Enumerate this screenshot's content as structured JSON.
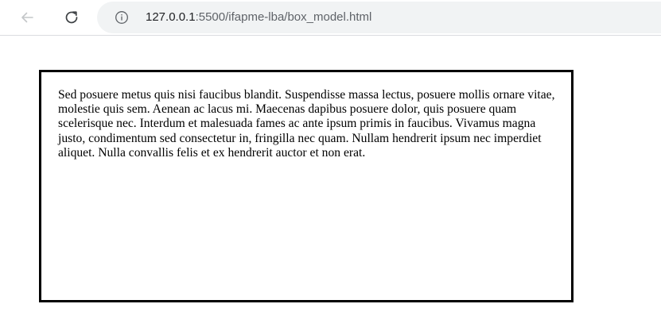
{
  "browser": {
    "url_host": "127.0.0.1",
    "url_path": ":5500/ifapme-lba/box_model.html",
    "icons": {
      "back": "arrow-left-icon",
      "reload": "reload-icon",
      "site_info": "info-icon"
    }
  },
  "page": {
    "paragraph": "Sed posuere metus quis nisi faucibus blandit. Suspendisse massa lectus, posuere mollis ornare vitae, molestie quis sem. Aenean ac lacus mi. Maecenas dapibus posuere dolor, quis posuere quam scelerisque nec. Interdum et malesuada fames ac ante ipsum primis in faucibus. Vivamus magna justo, condimentum sed consectetur in, fringilla nec quam. Nullam hendrerit ipsum nec imperdiet aliquet. Nulla convallis felis et ex hendrerit auctor et non erat."
  },
  "colors": {
    "box_border": "#000000",
    "address_bar_bg": "#f1f3f4",
    "url_path_text": "#5f6368"
  }
}
